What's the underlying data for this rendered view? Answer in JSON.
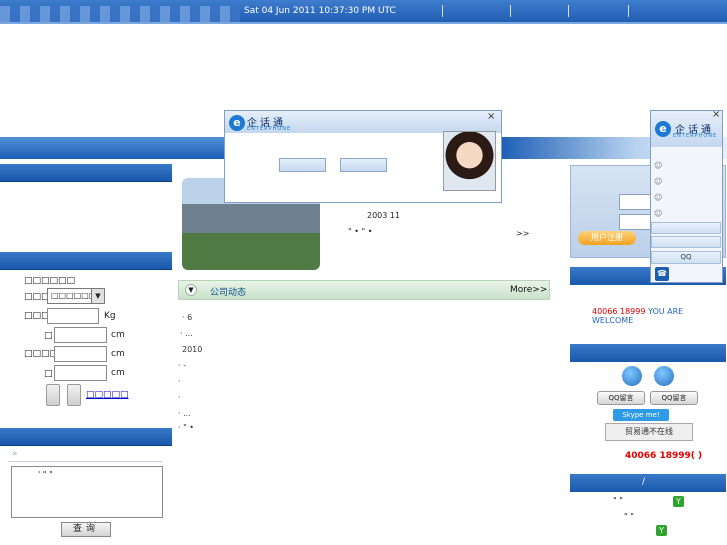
{
  "topbar": {
    "datetime": "Sat 04 Jun 2011 10:37:30 PM UTC"
  },
  "left": {
    "calc": {
      "title": "□□□□□□",
      "gender_label": "□□□□",
      "gender_value": "□□□□□□",
      "weight_label": "□□□□",
      "weight_unit": "Kg",
      "row3_label": "□",
      "unit_cm": "cm",
      "height_label": "□□□□□",
      "row5_label": "□",
      "link": "□□□□□"
    },
    "search": {
      "arrow": "»",
      "text": "'  \" \"",
      "button": "查询"
    }
  },
  "center": {
    "about_year": "2003 11",
    "about_quote": "\"   •              \"  •",
    "about_more": ">>",
    "news_title": "公司动态",
    "news_more": "More>>",
    "news": [
      {
        "t": "·       6"
      },
      {
        "t": "·                ..."
      },
      {
        "t": "2010"
      },
      {
        "t": "·       -"
      },
      {
        "t": "·"
      },
      {
        "t": "·"
      },
      {
        "t": "·                ..."
      },
      {
        "t": "·      \" •"
      }
    ]
  },
  "right": {
    "register_btn": "用户注册",
    "hotline_num": "40066 18999",
    "welcome_en": "YOU ARE WELCOME",
    "qq_label": "QQ留言",
    "skype": "Skype me!",
    "aliwangwang": "贸易通不在线",
    "hotline2": "40066 18999(   )",
    "service_head": "/",
    "quote1": "\"         \"",
    "quote2": "\"         \""
  },
  "popup": {
    "logo_text": "企话通",
    "logo_sub": "ENTERPHONE",
    "close": "×"
  },
  "sidebar_widget": {
    "logo_text": "企话通",
    "logo_sub": "ENTERPHONE",
    "close": "×",
    "qq": "QQ",
    "phone": "☎"
  },
  "colors": {
    "accent": "#1f5bb0",
    "hotline": "#e00000",
    "welcome": "#2166c9"
  }
}
